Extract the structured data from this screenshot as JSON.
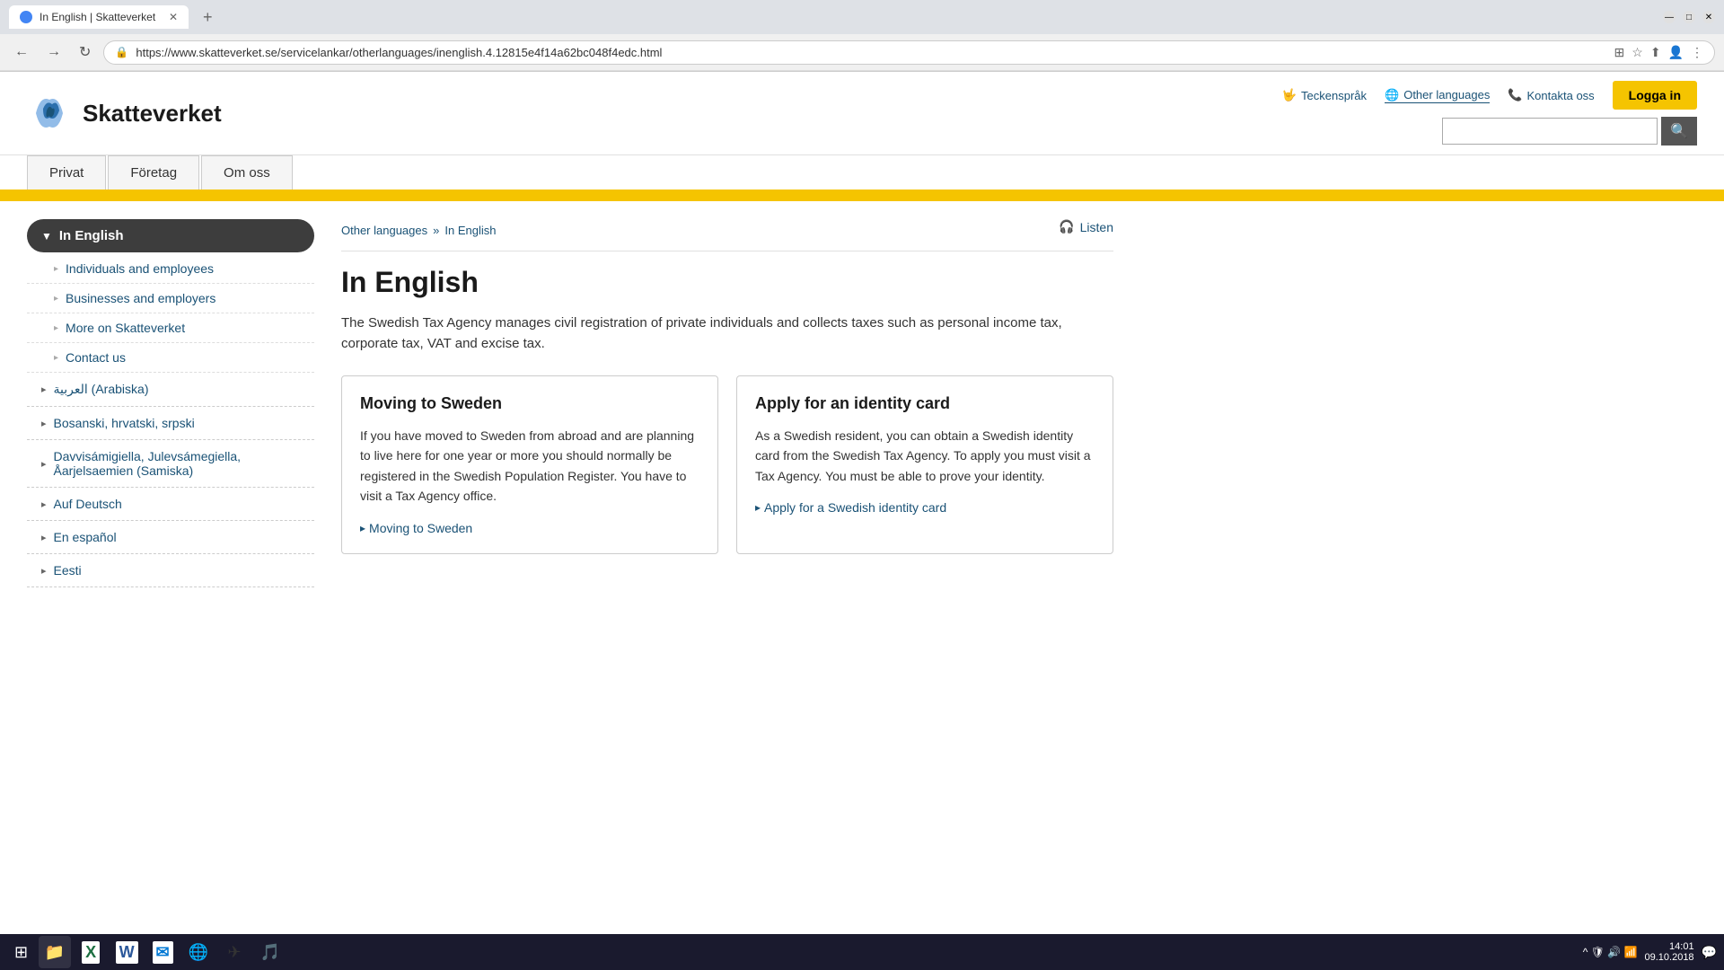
{
  "browser": {
    "tab_title": "In English | Skatteverket",
    "tab_favicon": "S",
    "url": "https://www.skatteverket.se/servicelankar/otherlanguages/inenglish.4.12815e4f14a62bc048f4edc.html",
    "new_tab_label": "+",
    "nav": {
      "back": "←",
      "forward": "→",
      "reload": "↻"
    }
  },
  "header": {
    "logo_text": "Skatteverket",
    "links": {
      "sign_language": "Teckenspråk",
      "other_languages": "Other languages",
      "contact": "Kontakta oss",
      "login": "Logga in"
    },
    "search_placeholder": ""
  },
  "nav": {
    "items": [
      "Privat",
      "Företag",
      "Om oss"
    ]
  },
  "sidebar": {
    "main_item": "In English",
    "sub_items": [
      "Individuals and employees",
      "Businesses and employers",
      "More on Skatteverket",
      "Contact us"
    ],
    "lang_items": [
      "العربية (Arabiska)",
      "Bosanski, hrvatski, srpski",
      "Davvisámigiella, Julevsámegiella, Åarjelsaemien (Samiska)",
      "Auf Deutsch",
      "En español",
      "Eesti"
    ]
  },
  "breadcrumb": {
    "parent": "Other languages",
    "separator": "»",
    "current": "In English"
  },
  "listen_label": "Listen",
  "main": {
    "title": "In English",
    "description": "The Swedish Tax Agency manages civil registration of private individuals and collects taxes such as personal income tax, corporate tax, VAT and excise tax.",
    "cards": [
      {
        "title": "Moving to Sweden",
        "text": "If you have moved to Sweden from abroad and are planning to live here for one year or more you should normally be registered in the Swedish Population Register. You have to visit a Tax Agency office.",
        "link_text": "Moving to Sweden",
        "link_arrow": "▸"
      },
      {
        "title": "Apply for an identity card",
        "text": "As a Swedish resident, you can obtain a Swedish identity card from the Swedish Tax Agency. To apply you must visit a Tax Agency. You must be able to prove your identity.",
        "link_text": "Apply for a Swedish identity card",
        "link_arrow": "▸"
      }
    ]
  },
  "taskbar": {
    "time": "14:01",
    "date": "09.10.2018",
    "start_icon": "⊞",
    "icons": [
      "📁",
      "📊",
      "W",
      "✉",
      "🌐",
      "✈",
      "🎵"
    ]
  }
}
